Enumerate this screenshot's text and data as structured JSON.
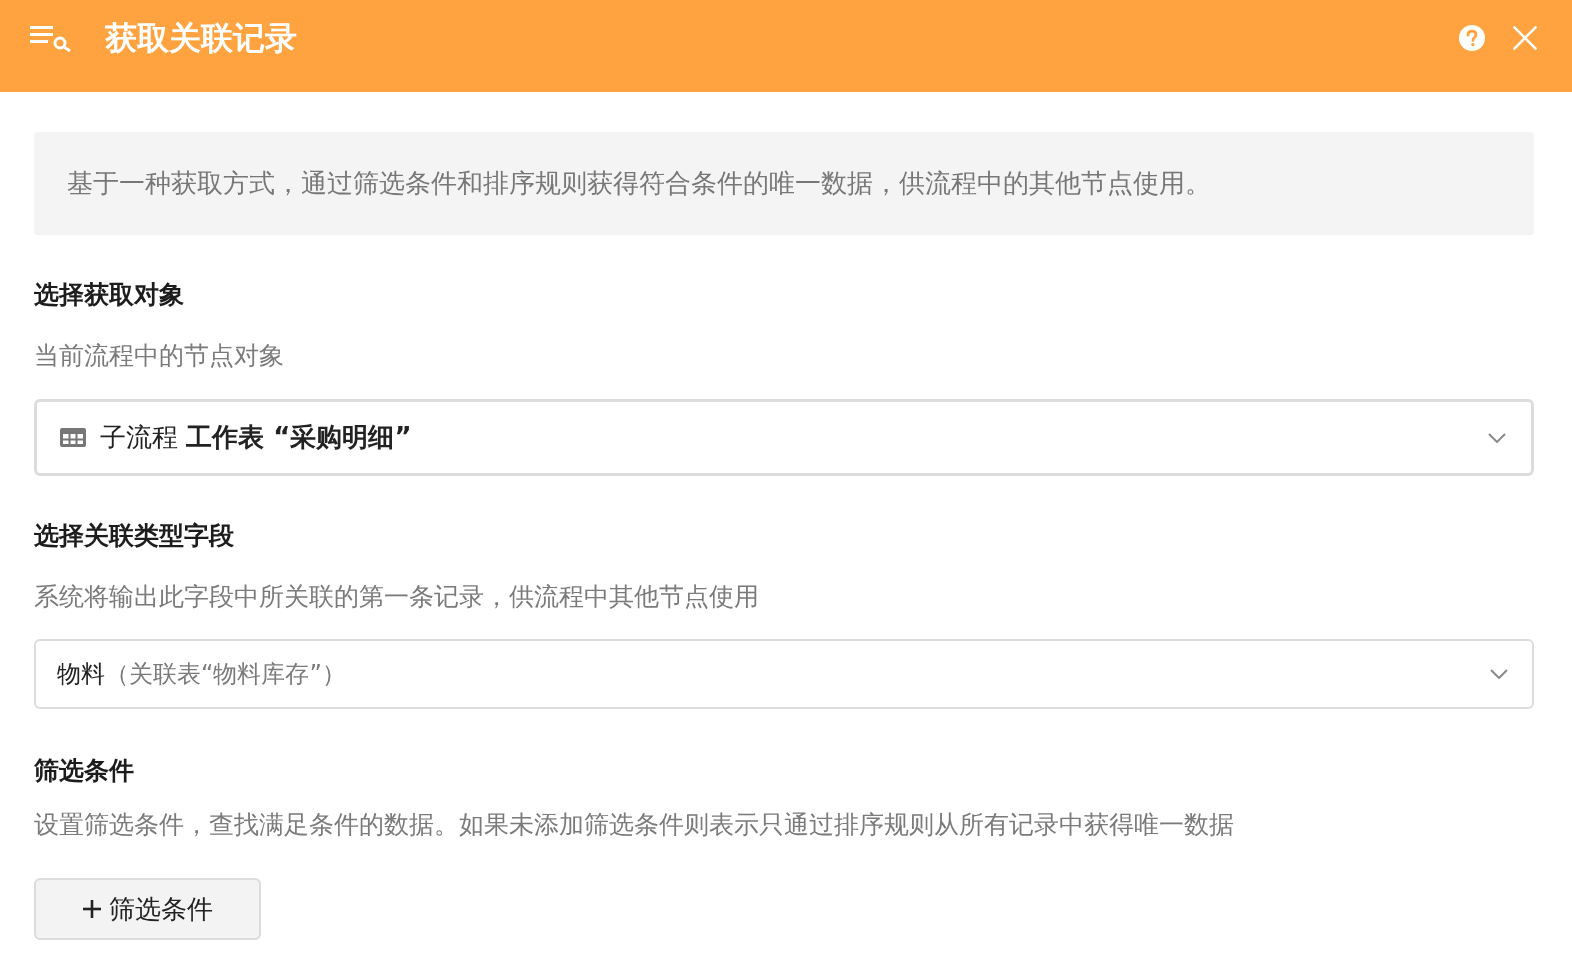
{
  "title_bar": {
    "title": "获取关联记录"
  },
  "info": "基于一种获取方式，通过筛选条件和排序规则获得符合条件的唯一数据，供流程中的其他节点使用。",
  "sections": [
    {
      "title": "选择获取对象",
      "description": "当前流程中的节点对象",
      "control": {
        "kind": "object-select",
        "value": "子流程 **工作表 “采购明细”**"
      }
    },
    {
      "title": "选择关联类型字段",
      "description": "系统将输出此字段中所关联的第一条记录，供流程中其他节点使用",
      "control": {
        "kind": "field-select",
        "value": "物料",
        "note": "（关联表“物料库存”）"
      }
    },
    {
      "title": "筛选条件",
      "description": "设置筛选条件，查找满足条件的数据。如果未添加筛选条件则表示只通过排序规则从所有记录中获得唯一数据",
      "control": {
        "kind": "add-button",
        "label": "筛选条件"
      }
    }
  ]
}
